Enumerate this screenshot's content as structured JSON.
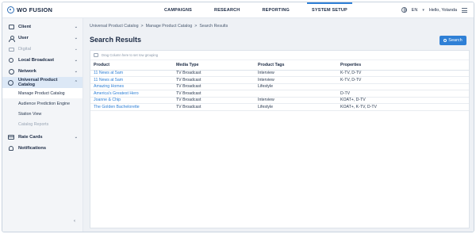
{
  "app": {
    "logo_text": "WO FUSION"
  },
  "nav": {
    "items": [
      "CAMPAIGNS",
      "RESEARCH",
      "REPORTING",
      "SYSTEM SETUP"
    ],
    "active": "SYSTEM SETUP"
  },
  "topright": {
    "language": "EN",
    "greeting": "Hello, Yolanda"
  },
  "sidebar": {
    "items": [
      {
        "label": "Client",
        "icon": "client-icon"
      },
      {
        "label": "User",
        "icon": "user-icon"
      },
      {
        "label": "Digital",
        "icon": "monitor-icon",
        "disabled": true
      },
      {
        "label": "Local Broadcast",
        "icon": "location-icon"
      },
      {
        "label": "Network",
        "icon": "network-icon"
      },
      {
        "label": "Universal Product Catalog",
        "icon": "catalog-icon",
        "expanded": true
      },
      {
        "label": "Rate Cards",
        "icon": "card-icon"
      },
      {
        "label": "Notifications",
        "icon": "bell-icon"
      }
    ],
    "subitems": [
      "Manage Product Catalog",
      "Audience Prediction Engine",
      "Station View",
      "Catalog Reports"
    ],
    "collapse_glyph": "‹"
  },
  "breadcrumb": [
    "Universal Product Catalog",
    "Manage Product Catalog",
    "Search Results"
  ],
  "breadcrumb_sep": ">",
  "page": {
    "title": "Search Results",
    "search_button": "Search"
  },
  "grid": {
    "group_hint": "Drag Column here to set row grouping",
    "columns": [
      "Product",
      "Media Type",
      "Product Tags",
      "Properties"
    ],
    "rows": [
      [
        "11 News at 5am",
        "TV Broadcast",
        "Interview",
        "K-TV, D-TV"
      ],
      [
        "11 News at 5am",
        "TV Broadcast",
        "Interview",
        "K-TV, D-TV"
      ],
      [
        "Amazing Homes",
        "TV Broadcast",
        "Lifestyle",
        ""
      ],
      [
        "America's Greatest Hero",
        "TV Broadcast",
        "",
        "D-TV"
      ],
      [
        "Joanne & Chip",
        "TV Broadcast",
        "Interview",
        "KOAT+, D-TV"
      ],
      [
        "The Golden Bachelorette",
        "TV Broadcast",
        "Lifestyle",
        "KOAT+, K-TV, D-TV"
      ]
    ]
  },
  "colors": {
    "accent": "#2f80d6",
    "sidebar_bg": "#f3f5f8",
    "main_bg": "#eef1f5"
  }
}
